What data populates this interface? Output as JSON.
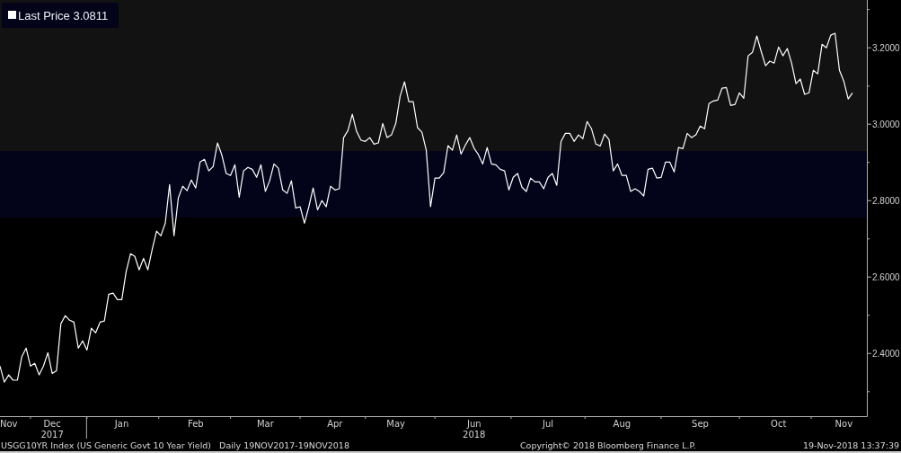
{
  "chart_data": {
    "type": "line",
    "ylim": [
      2.236,
      3.318
    ],
    "yticks": [
      {
        "value": 2.4,
        "label": "2.4000"
      },
      {
        "value": 2.6,
        "label": "2.6000"
      },
      {
        "value": 2.8,
        "label": "2.8000"
      },
      {
        "value": 3.0,
        "label": "3.0000"
      },
      {
        "value": 3.2,
        "label": "3.2000"
      }
    ],
    "categories": [
      null,
      null,
      "Nov",
      null,
      null,
      null,
      null,
      null,
      null,
      null,
      null,
      null,
      "Dec",
      null,
      null,
      null,
      null,
      null,
      null,
      null,
      null,
      null,
      null,
      null,
      null,
      null,
      null,
      null,
      "Jan",
      null,
      null,
      null,
      null,
      null,
      null,
      null,
      null,
      null,
      null,
      null,
      null,
      null,
      null,
      null,
      null,
      "Feb",
      null,
      null,
      null,
      null,
      null,
      null,
      null,
      null,
      null,
      null,
      null,
      null,
      null,
      null,
      null,
      "Mar",
      null,
      null,
      null,
      null,
      null,
      null,
      null,
      null,
      null,
      null,
      null,
      null,
      null,
      null,
      null,
      "Apr",
      null,
      null,
      null,
      null,
      null,
      null,
      null,
      null,
      null,
      null,
      null,
      null,
      null,
      "May",
      null,
      null,
      null,
      null,
      null,
      null,
      null,
      null,
      null,
      null,
      null,
      null,
      null,
      null,
      null,
      null,
      null,
      "Jun",
      null,
      null,
      null,
      null,
      null,
      null,
      null,
      null,
      null,
      null,
      null,
      null,
      null,
      null,
      null,
      null,
      "Jul",
      null,
      null,
      null,
      null,
      null,
      null,
      null,
      null,
      null,
      null,
      null,
      null,
      null,
      null,
      null,
      null,
      "Aug",
      null,
      null,
      null,
      null,
      null,
      null,
      null,
      null,
      null,
      null,
      null,
      null,
      null,
      null,
      null,
      null,
      null,
      "Sep",
      null,
      null,
      null,
      null,
      null,
      null,
      null,
      null,
      null,
      null,
      null,
      null,
      null,
      null,
      null,
      null,
      null,
      "Oct",
      null,
      null,
      null,
      null,
      null,
      null,
      null,
      null,
      null,
      null,
      null,
      null,
      null,
      null,
      "Nov",
      null,
      null
    ],
    "series": [
      {
        "name": "Last Price",
        "color": "#ffffff",
        "values": [
          2.367,
          2.325,
          2.344,
          2.33,
          2.33,
          2.391,
          2.414,
          2.367,
          2.374,
          2.344,
          2.367,
          2.402,
          2.348,
          2.355,
          2.478,
          2.499,
          2.487,
          2.482,
          2.414,
          2.433,
          2.409,
          2.466,
          2.454,
          2.482,
          2.485,
          2.555,
          2.558,
          2.541,
          2.541,
          2.614,
          2.661,
          2.654,
          2.619,
          2.649,
          2.619,
          2.673,
          2.72,
          2.708,
          2.741,
          2.842,
          2.708,
          2.807,
          2.838,
          2.826,
          2.854,
          2.833,
          2.901,
          2.908,
          2.878,
          2.889,
          2.951,
          2.92,
          2.871,
          2.866,
          2.894,
          2.809,
          2.878,
          2.887,
          2.882,
          2.861,
          2.894,
          2.824,
          2.852,
          2.896,
          2.885,
          2.828,
          2.819,
          2.852,
          2.781,
          2.784,
          2.741,
          2.784,
          2.833,
          2.776,
          2.8,
          2.784,
          2.838,
          2.828,
          2.831,
          2.965,
          2.983,
          3.026,
          2.981,
          2.958,
          2.955,
          2.965,
          2.948,
          2.951,
          3.002,
          2.965,
          2.972,
          3.002,
          3.073,
          3.111,
          3.059,
          3.059,
          2.991,
          2.979,
          2.932,
          2.784,
          2.859,
          2.859,
          2.873,
          2.944,
          2.932,
          2.972,
          2.922,
          2.946,
          2.965,
          2.937,
          2.92,
          2.896,
          2.939,
          2.896,
          2.894,
          2.882,
          2.878,
          2.828,
          2.861,
          2.871,
          2.835,
          2.824,
          2.859,
          2.849,
          2.849,
          2.831,
          2.861,
          2.871,
          2.84,
          2.955,
          2.976,
          2.976,
          2.955,
          2.972,
          2.962,
          3.007,
          2.988,
          2.948,
          2.943,
          2.974,
          2.96,
          2.878,
          2.896,
          2.866,
          2.866,
          2.824,
          2.831,
          2.824,
          2.812,
          2.882,
          2.885,
          2.859,
          2.861,
          2.901,
          2.901,
          2.875,
          2.939,
          2.936,
          2.976,
          2.965,
          2.972,
          2.995,
          2.988,
          3.054,
          3.061,
          3.063,
          3.094,
          3.096,
          3.049,
          3.052,
          3.082,
          3.068,
          3.179,
          3.188,
          3.231,
          3.191,
          3.153,
          3.165,
          3.16,
          3.202,
          3.179,
          3.198,
          3.16,
          3.106,
          3.118,
          3.078,
          3.082,
          3.141,
          3.132,
          3.209,
          3.2,
          3.233,
          3.238,
          3.141,
          3.113,
          3.066,
          3.082
        ]
      }
    ],
    "stacked": false
  },
  "year_labels": [
    "2017",
    "2018"
  ],
  "legend": {
    "value": "3.0811"
  },
  "footer": {
    "security": "USGG10YR Index (US Generic Govt 10 Year Yield)",
    "period": "Daily 19NOV2017-19NOV2018",
    "copyright": "Copyright© 2018 Bloomberg Finance L.P.",
    "timestamp": "19-Nov-2018 13:37:39"
  }
}
